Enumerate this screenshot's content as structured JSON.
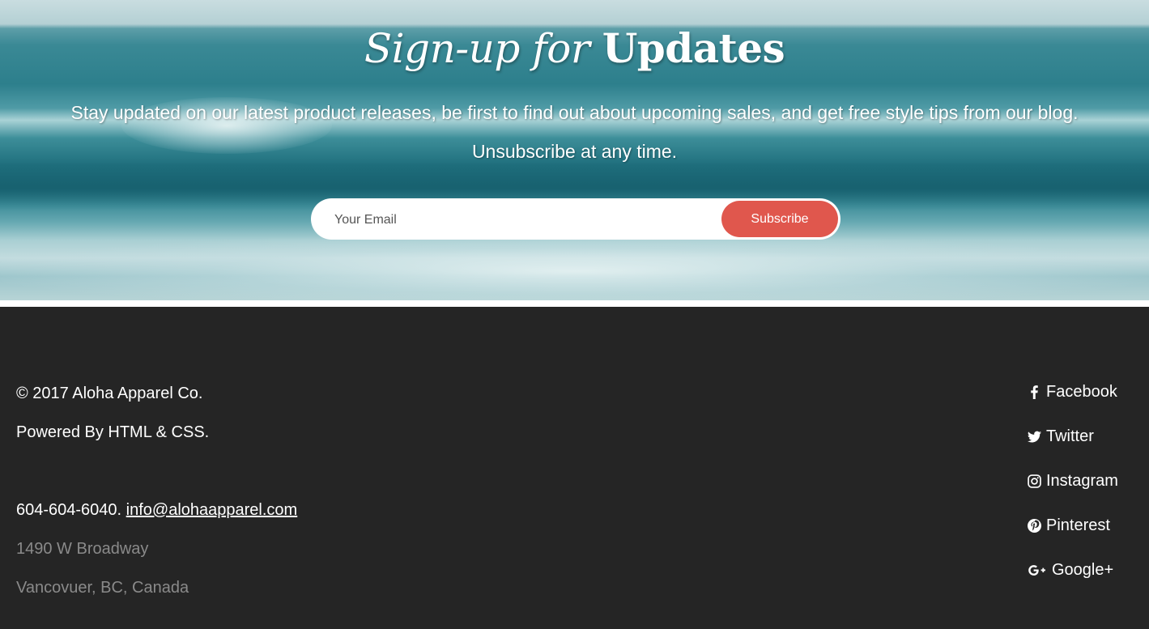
{
  "signup": {
    "title_italic": "Sign-up for",
    "title_bold": "Updates",
    "description_line1": "Stay updated on our latest product releases, be first to find out about upcoming sales, and get free style tips from our blog.",
    "description_line2": "Unsubscribe at any time.",
    "email_placeholder": "Your Email",
    "email_value": "",
    "subscribe_label": "Subscribe"
  },
  "footer": {
    "copyright": "© 2017 Aloha Apparel Co.",
    "powered_by": "Powered By HTML & CSS.",
    "phone": "604-604-6040.",
    "email": "info@alohaapparel.com",
    "address_line1": "1490 W Broadway",
    "address_line2": "Vancovuer, BC, Canada",
    "social": [
      {
        "label": "Facebook",
        "icon": "facebook-icon"
      },
      {
        "label": "Twitter",
        "icon": "twitter-icon"
      },
      {
        "label": "Instagram",
        "icon": "instagram-icon"
      },
      {
        "label": "Pinterest",
        "icon": "pinterest-icon"
      },
      {
        "label": "Google+",
        "icon": "google-plus-icon"
      }
    ]
  },
  "colors": {
    "accent": "#e0574d",
    "footer_bg": "#252525",
    "muted_text": "#8a8a8a"
  }
}
